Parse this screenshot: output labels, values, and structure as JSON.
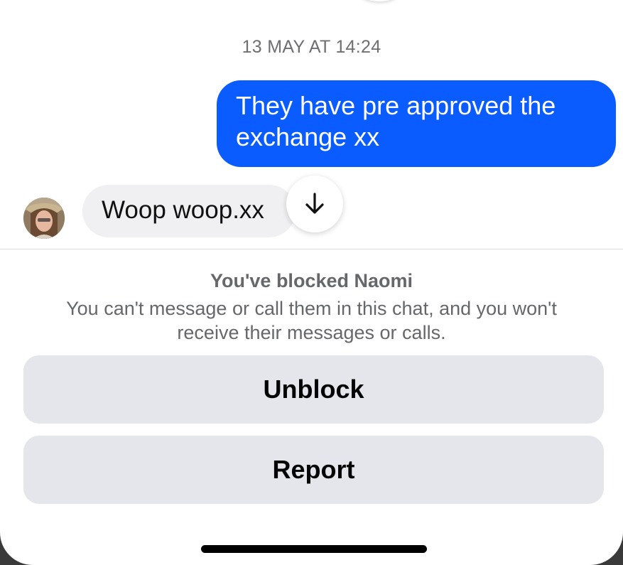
{
  "chat": {
    "timestamp": "13 MAY AT 14:24",
    "outgoing_message": "They have pre approved the exchange xx",
    "incoming_message": "Woop woop.xx"
  },
  "scroll_button": {
    "icon": "arrow-down-icon"
  },
  "blocked_notice": {
    "title": "You've blocked Naomi",
    "description": "You can't message or call them in this chat, and you won't receive their messages or calls."
  },
  "actions": {
    "unblock_label": "Unblock",
    "report_label": "Report"
  },
  "colors": {
    "outgoing_bubble": "#0a5cff",
    "incoming_bubble": "#f0f0f2",
    "action_button": "#e4e6eb",
    "muted_text": "#65676b"
  }
}
